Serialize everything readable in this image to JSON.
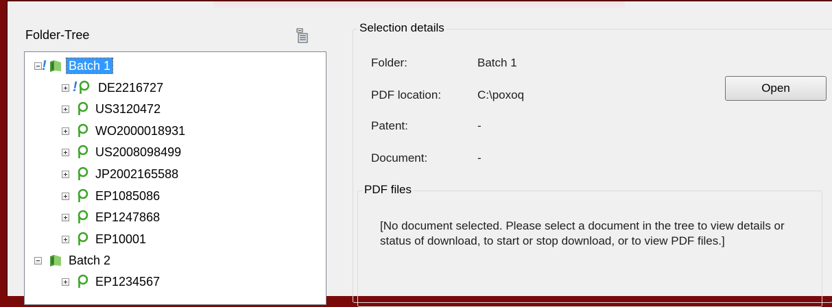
{
  "folder_tree": {
    "title": "Folder-Tree",
    "items": [
      {
        "label": "Batch 1",
        "kind": "folder",
        "warning": true,
        "selected": true,
        "expanded": true
      },
      {
        "label": "DE2216727",
        "kind": "document",
        "warning": true
      },
      {
        "label": "US3120472",
        "kind": "document",
        "warning": false
      },
      {
        "label": "WO2000018931",
        "kind": "document",
        "warning": false
      },
      {
        "label": "US2008098499",
        "kind": "document",
        "warning": false
      },
      {
        "label": "JP2002165588",
        "kind": "document",
        "warning": false
      },
      {
        "label": "EP1085086",
        "kind": "document",
        "warning": false
      },
      {
        "label": "EP1247868",
        "kind": "document",
        "warning": false
      },
      {
        "label": "EP10001",
        "kind": "document",
        "warning": false
      },
      {
        "label": "Batch 2",
        "kind": "folder",
        "warning": false,
        "selected": false,
        "expanded": true
      },
      {
        "label": "EP1234567",
        "kind": "document",
        "warning": false
      }
    ]
  },
  "selection_details": {
    "title": "Selection details",
    "folder_label": "Folder:",
    "folder_value": "Batch 1",
    "pdf_location_label": "PDF location:",
    "pdf_location_value": "C:\\poxoq",
    "patent_label": "Patent:",
    "patent_value": "-",
    "document_label": "Document:",
    "document_value": "-",
    "open_button": "Open"
  },
  "pdf_files": {
    "title": "PDF files",
    "message": "[No document selected. Please select a document in the tree to view details or status of download, to start or stop download, or to view PDF files.]"
  },
  "colors": {
    "selection": "#3399ff",
    "document_icon": "#3ea52a",
    "warning": "#2a7fd4",
    "window_frame": "#7a0a0a"
  }
}
